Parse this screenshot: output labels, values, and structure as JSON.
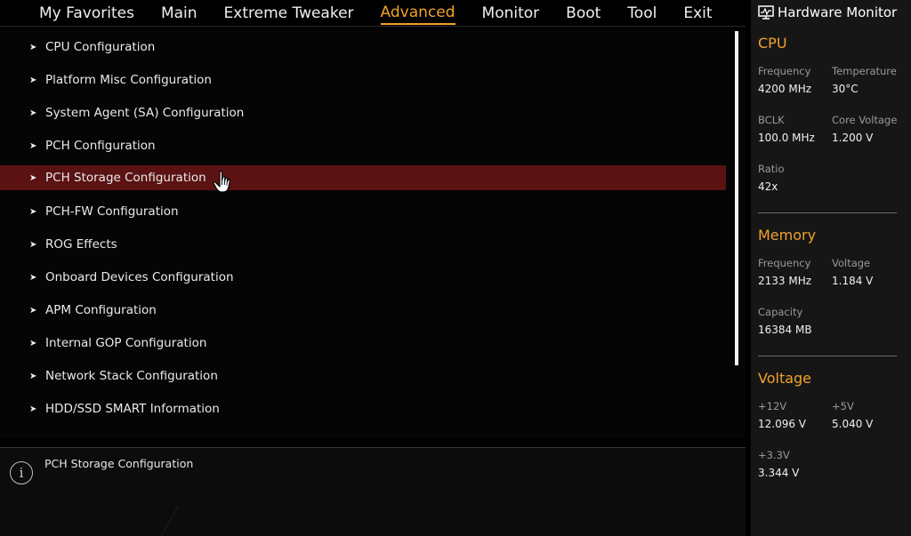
{
  "nav": {
    "tabs": [
      "My Favorites",
      "Main",
      "Extreme Tweaker",
      "Advanced",
      "Monitor",
      "Boot",
      "Tool",
      "Exit"
    ],
    "active": "Advanced"
  },
  "menu": {
    "items": [
      "CPU Configuration",
      "Platform Misc Configuration",
      "System Agent (SA) Configuration",
      "PCH Configuration",
      "PCH Storage Configuration",
      "PCH-FW Configuration",
      "ROG Effects",
      "Onboard Devices Configuration",
      "APM Configuration",
      "Internal GOP Configuration",
      "Network Stack Configuration",
      "HDD/SSD SMART Information"
    ],
    "selected": "PCH Storage Configuration"
  },
  "help": {
    "text": "PCH Storage Configuration"
  },
  "hwmon": {
    "title": "Hardware Monitor",
    "cpu": {
      "title": "CPU",
      "frequency_label": "Frequency",
      "frequency": "4200 MHz",
      "temperature_label": "Temperature",
      "temperature": "30°C",
      "bclk_label": "BCLK",
      "bclk": "100.0 MHz",
      "core_voltage_label": "Core Voltage",
      "core_voltage": "1.200 V",
      "ratio_label": "Ratio",
      "ratio": "42x"
    },
    "memory": {
      "title": "Memory",
      "frequency_label": "Frequency",
      "frequency": "2133 MHz",
      "voltage_label": "Voltage",
      "voltage": "1.184 V",
      "capacity_label": "Capacity",
      "capacity": "16384 MB"
    },
    "voltage": {
      "title": "Voltage",
      "v12_label": "+12V",
      "v12": "12.096 V",
      "v5_label": "+5V",
      "v5": "5.040 V",
      "v33_label": "+3.3V",
      "v33": "3.344 V"
    }
  },
  "colors": {
    "accent": "#f2a22c",
    "selected_row": "#5a1212",
    "panel_bg": "#161616"
  }
}
